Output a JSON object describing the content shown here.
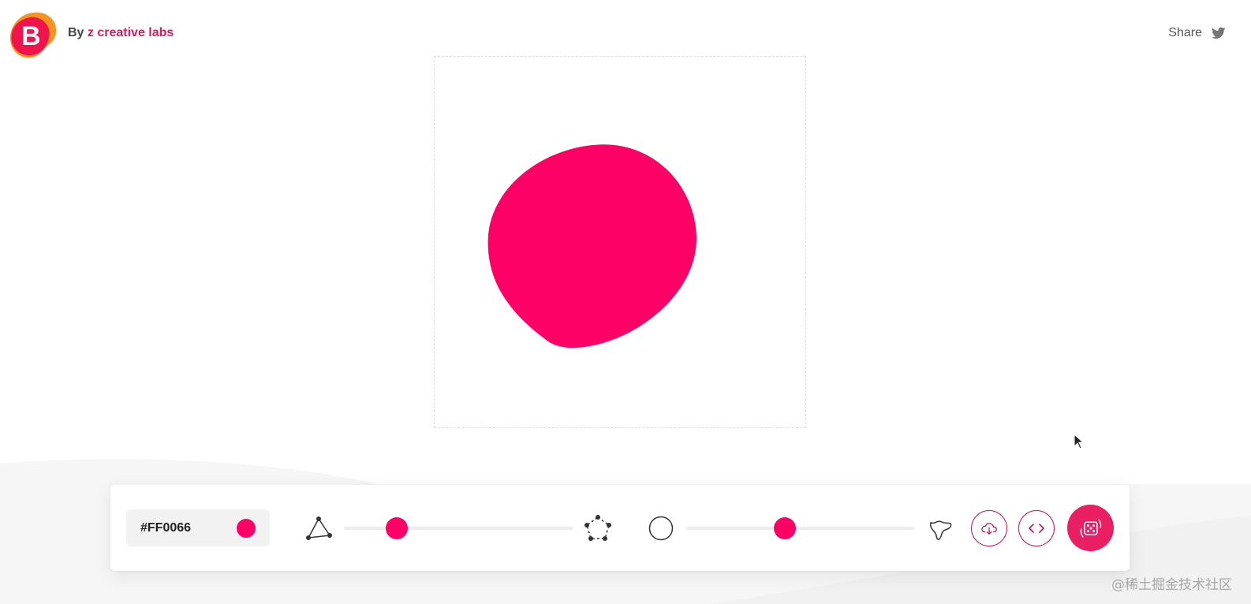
{
  "header": {
    "by_label": "By",
    "brand_name": "z creative labs",
    "logo_letter": "B",
    "share_label": "Share"
  },
  "editor": {
    "color_value": "#FF0066",
    "complexity_level_percent": 23,
    "contrast_level_percent": 43
  },
  "toolbar": {
    "download_icon": "cloud-download-icon",
    "code_icon": "code-icon",
    "random_icon": "dice-icon"
  },
  "watermark": "@稀土掘金技术社区",
  "colors": {
    "blob": "#FF0066",
    "accent": "#C2185B",
    "random_button": "#E91E63",
    "logo_pink": "#F0134D",
    "logo_orange": "#F7931E"
  }
}
